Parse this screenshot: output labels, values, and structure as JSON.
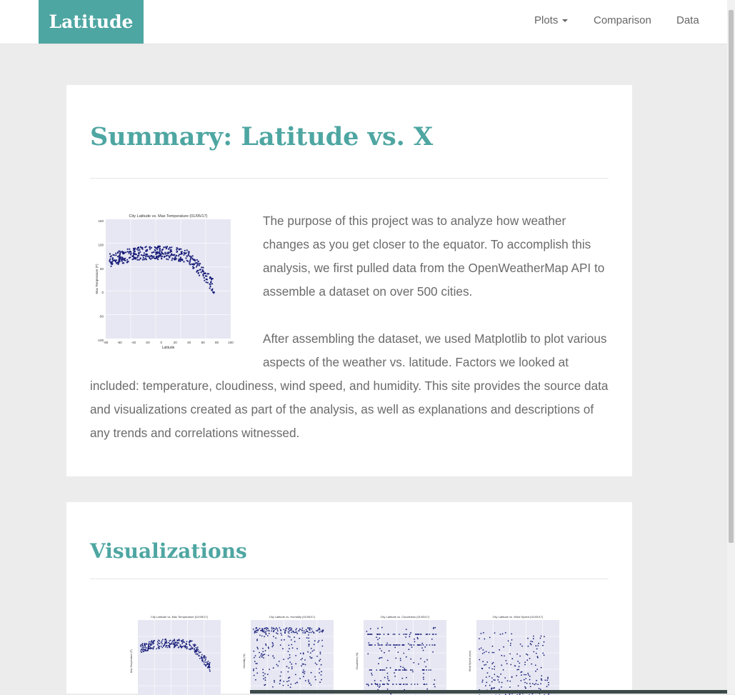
{
  "navbar": {
    "brand": "Latitude",
    "items": [
      {
        "label": "Plots",
        "dropdown": true
      },
      {
        "label": "Comparison",
        "dropdown": false
      },
      {
        "label": "Data",
        "dropdown": false
      }
    ]
  },
  "summary": {
    "title": "Summary: Latitude vs. X",
    "paragraphs": [
      "The purpose of this project was to analyze how weather changes as you get closer to the equator. To accomplish this analysis, we first pulled data from the OpenWeatherMap API to assemble a dataset on over 500 cities.",
      "After assembling the dataset, we used Matplotlib to plot various aspects of the weather vs. latitude. Factors we looked at included: temperature, cloudiness, wind speed, and humidity. This site provides the source data and visualizations created as part of the analysis, as well as explanations and descriptions of any trends and correlations witnessed."
    ],
    "plot": {
      "title": "City Latitude vs. Max Temperature (01/05/17)",
      "xlabel": "Latitude",
      "ylabel": "Max Temperature (F)",
      "xticks": [
        "-80",
        "-60",
        "-40",
        "-20",
        "0",
        "20",
        "40",
        "60",
        "80",
        "100"
      ],
      "yticks": [
        "150",
        "100",
        "50",
        "0",
        "-50",
        "-100"
      ]
    }
  },
  "visualizations": {
    "title": "Visualizations",
    "thumbnails": [
      {
        "title": "City Latitude vs. Max Temperature (01/05/17)",
        "kind": "temperature",
        "ylabel": "Max Temperature (F)"
      },
      {
        "title": "City Latitude vs. Humidity (01/05/17)",
        "kind": "humidity",
        "ylabel": "Humidity (%)"
      },
      {
        "title": "City Latitude vs. Cloudiness (01/05/17)",
        "kind": "cloudiness",
        "ylabel": "Cloudiness (%)"
      },
      {
        "title": "City Latitude vs. Wind Speed (01/05/17)",
        "kind": "wind",
        "ylabel": "Wind Speed (mph)"
      }
    ]
  },
  "colors": {
    "accent": "#4ea6a2",
    "point": "#1a1f7a",
    "plot_bg": "#e6e7f2"
  }
}
